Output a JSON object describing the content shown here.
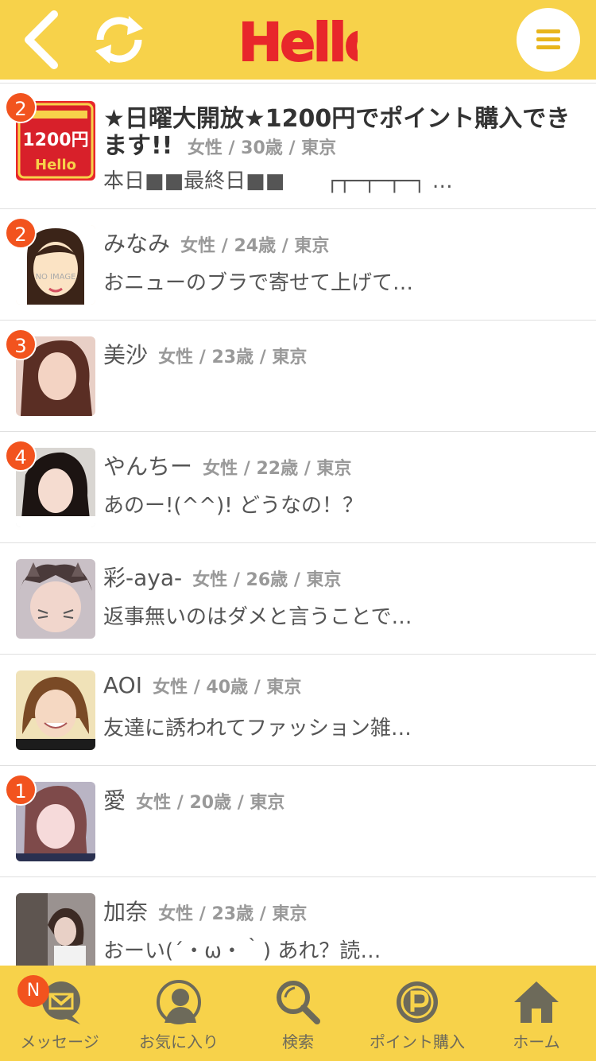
{
  "header": {
    "logo": "Hello"
  },
  "items": [
    {
      "badge": "2",
      "title": "★日曜大開放★1200円でポイント購入できます!!",
      "meta": "女性 / 30歳 / 東京",
      "message": "本日■■最終日■■　　┌┬─┬─┬─┐ …",
      "avatar_text": "1200円"
    },
    {
      "badge": "2",
      "name": "みなみ",
      "meta": "女性 / 24歳 / 東京",
      "message": "おニューのブラで寄せて上げて…",
      "avatar_text": "NO IMAGE"
    },
    {
      "badge": "3",
      "name": "美沙",
      "meta": "女性 / 23歳 / 東京",
      "message": ""
    },
    {
      "badge": "4",
      "name": "やんちー",
      "meta": "女性 / 22歳 / 東京",
      "message": "あのー!(^^)! どうなの！？"
    },
    {
      "badge": "",
      "name": "彩-aya-",
      "meta": "女性 / 26歳 / 東京",
      "message": "返事無いのはダメと言うことで…"
    },
    {
      "badge": "",
      "name": "AOI",
      "meta": "女性 / 40歳 / 東京",
      "message": "友達に誘われてファッション雑…"
    },
    {
      "badge": "1",
      "name": "愛",
      "meta": "女性 / 20歳 / 東京",
      "message": ""
    },
    {
      "badge": "",
      "name": "加奈",
      "meta": "女性 / 23歳 / 東京",
      "message": "おーい(´・ω・｀) あれ？読…"
    }
  ],
  "tabbar": {
    "messages": {
      "label": "メッセージ",
      "badge": "N"
    },
    "favorites": {
      "label": "お気に入り"
    },
    "search": {
      "label": "検索"
    },
    "points": {
      "label": "ポイント購入"
    },
    "home": {
      "label": "ホーム"
    }
  },
  "colors": {
    "accent": "#f7d24a",
    "badge": "#f2531e",
    "logo_red": "#e8272b"
  }
}
